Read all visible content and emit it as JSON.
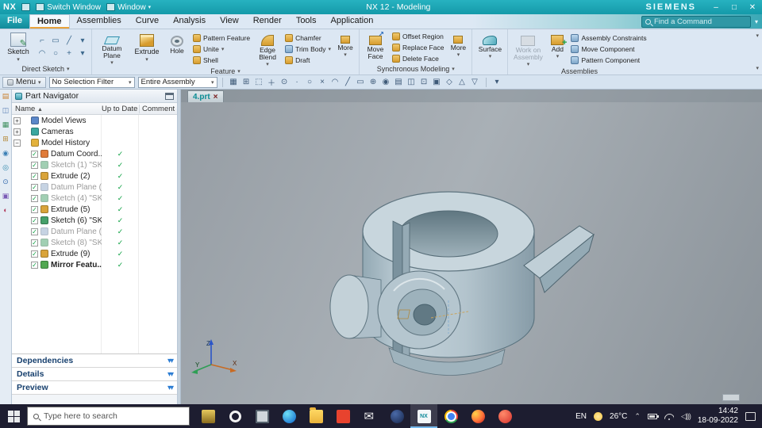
{
  "colors": {
    "titlebar_teal": "#149aa9",
    "ribbon_bg": "#dce7f3",
    "check_green": "#0aa040",
    "taskbar_dark": "#1d1d30",
    "tab_text_teal": "#0a8c94"
  },
  "titlebar": {
    "logo": "NX",
    "switch_window": "Switch Window",
    "window_menu": "Window",
    "title": "NX 12 - Modeling",
    "brand": "SIEMENS",
    "minimize": "–",
    "maximize": "□",
    "close": "✕"
  },
  "menubar": {
    "search_placeholder": "Find a Command",
    "items": [
      {
        "name": "menu-file",
        "label": "File",
        "state": "m-file"
      },
      {
        "name": "tab-home",
        "label": "Home",
        "state": "m-active"
      },
      {
        "name": "tab-assemblies",
        "label": "Assemblies",
        "state": ""
      },
      {
        "name": "tab-curve",
        "label": "Curve",
        "state": ""
      },
      {
        "name": "tab-analysis",
        "label": "Analysis",
        "state": ""
      },
      {
        "name": "tab-view",
        "label": "View",
        "state": ""
      },
      {
        "name": "tab-render",
        "label": "Render",
        "state": ""
      },
      {
        "name": "tab-tools",
        "label": "Tools",
        "state": ""
      },
      {
        "name": "tab-application",
        "label": "Application",
        "state": ""
      }
    ]
  },
  "ribbon": {
    "sketch": "Sketch",
    "direct_sketch_icons": [
      {
        "name": "profile-icon",
        "glyph": "⌐"
      },
      {
        "name": "rectangle-icon",
        "glyph": "▭"
      },
      {
        "name": "line-icon",
        "glyph": "╱"
      },
      {
        "name": "more-curve-icon",
        "glyph": "▾"
      },
      {
        "name": "arc-icon",
        "glyph": "◠"
      },
      {
        "name": "circle-icon",
        "glyph": "○"
      },
      {
        "name": "fillet-icon",
        "glyph": "+"
      },
      {
        "name": "more-curve2-icon",
        "glyph": "▾"
      }
    ],
    "datum_plane": "Datum Plane",
    "extrude": "Extrude",
    "hole": "Hole",
    "pattern_feature": "Pattern Feature",
    "unite": "Unite",
    "shell": "Shell",
    "edge_blend": "Edge Blend",
    "chamfer": "Chamfer",
    "trim_body": "Trim Body",
    "draft": "Draft",
    "more_feature": "More",
    "move_face": "Move Face",
    "offset_region": "Offset Region",
    "replace_face": "Replace Face",
    "delete_face": "Delete Face",
    "more_sync": "More",
    "surface": "Surface",
    "work_on_assembly": "Work on Assembly",
    "add": "Add",
    "assembly_constraints": "Assembly Constraints",
    "move_component": "Move Component",
    "pattern_component": "Pattern Component"
  },
  "group_labels": {
    "direct_sketch": "Direct Sketch",
    "feature": "Feature",
    "synchronous": "Synchronous Modeling",
    "assemblies": "Assemblies"
  },
  "toolbar": {
    "menu": "Menu",
    "selection_filter": "No Selection Filter",
    "scope": "Entire Assembly",
    "icons": [
      {
        "name": "selection-scope-icon",
        "glyph": "▦"
      },
      {
        "name": "snap-grid-icon",
        "glyph": "⊞"
      },
      {
        "name": "window-select-icon",
        "glyph": "⬚"
      },
      {
        "name": "highlight-icon",
        "glyph": "＋"
      },
      {
        "name": "snap-point-icon",
        "glyph": "⊙"
      },
      {
        "name": "endpoint-icon",
        "glyph": "∙"
      },
      {
        "name": "circle-center-icon",
        "glyph": "○"
      },
      {
        "name": "intersection-icon",
        "glyph": "×"
      },
      {
        "name": "arc-snap-icon",
        "glyph": "◠"
      },
      {
        "name": "line-snap-icon",
        "glyph": "╱"
      },
      {
        "name": "face-snap-icon",
        "glyph": "▭"
      },
      {
        "name": "quadrant-icon",
        "glyph": "⊕"
      },
      {
        "name": "existing-point-icon",
        "glyph": "◉"
      },
      {
        "name": "shaded-view-icon",
        "glyph": "▤"
      },
      {
        "name": "wireframe-icon",
        "glyph": "◫"
      },
      {
        "name": "fit-view-icon",
        "glyph": "⊡"
      },
      {
        "name": "render-style-icon",
        "glyph": "▣"
      },
      {
        "name": "orient-view-icon",
        "glyph": "◇"
      },
      {
        "name": "up-view-icon",
        "glyph": "△"
      },
      {
        "name": "down-view-icon",
        "glyph": "▽"
      }
    ]
  },
  "resource_bar": {
    "icons": [
      {
        "name": "assembly-navigator-icon",
        "glyph": "▤",
        "style": "color:#c77f2e"
      },
      {
        "name": "constraint-navigator-icon",
        "glyph": "◫",
        "style": "color:#5a7fb5"
      },
      {
        "name": "part-navigator-icon",
        "glyph": "▦",
        "style": "color:#3f8f5f"
      },
      {
        "name": "reuse-library-icon",
        "glyph": "⊞",
        "style": "color:#b58a3a"
      },
      {
        "name": "hd3d-tools-icon",
        "glyph": "◉",
        "style": "color:#3a7fb5"
      },
      {
        "name": "web-browser-icon",
        "glyph": "◎",
        "style": "color:#2e86ab"
      },
      {
        "name": "history-icon",
        "glyph": "⊙",
        "style": "color:#3a6fb0"
      },
      {
        "name": "process-studio-icon",
        "glyph": "▣",
        "style": "color:#7a5ab5"
      },
      {
        "name": "roles-icon",
        "glyph": "◐",
        "style": "color:#b03a5a"
      }
    ]
  },
  "part_navigator": {
    "title": "Part Navigator",
    "col_name": "Name",
    "col_uptodate": "Up to Date",
    "col_comment": "Comment",
    "rows": [
      {
        "indent": "ind0",
        "expand": "+",
        "check": "",
        "icon": "ic-views",
        "label": "Model Views",
        "state": "",
        "uptodate": ""
      },
      {
        "indent": "ind0",
        "expand": "+",
        "check": "",
        "icon": "ic-cameras",
        "label": "Cameras",
        "state": "",
        "uptodate": ""
      },
      {
        "indent": "ind0",
        "expand": "−",
        "check": "",
        "icon": "ic-history",
        "label": "Model History",
        "state": "",
        "uptodate": ""
      },
      {
        "indent": "ind1",
        "expand": "",
        "check": "✓",
        "icon": "ic-csys",
        "label": "Datum Coord...",
        "state": "",
        "uptodate": "✓"
      },
      {
        "indent": "ind1",
        "expand": "",
        "check": "✓",
        "icon": "ic-sketch",
        "label": "Sketch (1) \"SK...",
        "state": "grayed",
        "uptodate": "✓"
      },
      {
        "indent": "ind1",
        "expand": "",
        "check": "✓",
        "icon": "ic-extrude2",
        "label": "Extrude (2)",
        "state": "",
        "uptodate": "✓"
      },
      {
        "indent": "ind1",
        "expand": "",
        "check": "✓",
        "icon": "ic-datum",
        "label": "Datum Plane (...",
        "state": "grayed",
        "uptodate": "✓"
      },
      {
        "indent": "ind1",
        "expand": "",
        "check": "✓",
        "icon": "ic-sketch",
        "label": "Sketch (4) \"SK...",
        "state": "grayed",
        "uptodate": "✓"
      },
      {
        "indent": "ind1",
        "expand": "",
        "check": "✓",
        "icon": "ic-extrude2",
        "label": "Extrude (5)",
        "state": "",
        "uptodate": "✓"
      },
      {
        "indent": "ind1",
        "expand": "",
        "check": "✓",
        "icon": "ic-sketch",
        "label": "Sketch (6) \"SK...",
        "state": "",
        "uptodate": "✓"
      },
      {
        "indent": "ind1",
        "expand": "",
        "check": "✓",
        "icon": "ic-datum",
        "label": "Datum Plane (...",
        "state": "grayed",
        "uptodate": "✓"
      },
      {
        "indent": "ind1",
        "expand": "",
        "check": "✓",
        "icon": "ic-sketch",
        "label": "Sketch (8) \"SK...",
        "state": "grayed",
        "uptodate": "✓"
      },
      {
        "indent": "ind1",
        "expand": "",
        "check": "✓",
        "icon": "ic-extrude2",
        "label": "Extrude (9)",
        "state": "",
        "uptodate": "✓"
      },
      {
        "indent": "ind1",
        "expand": "",
        "check": "✓",
        "icon": "ic-mirror",
        "label": "Mirror Featu...",
        "state": "selected",
        "uptodate": "✓"
      }
    ],
    "sections": [
      {
        "name": "section-dependencies",
        "label": "Dependencies"
      },
      {
        "name": "section-details",
        "label": "Details"
      },
      {
        "name": "section-preview",
        "label": "Preview"
      }
    ]
  },
  "viewport": {
    "tab": "4.prt",
    "tab_close": "×",
    "triad_x": "X",
    "triad_y": "Y",
    "triad_z": "Z"
  },
  "taskbar": {
    "search_placeholder": "Type here to search",
    "language": "EN",
    "temperature": "26°C",
    "time": "14:42",
    "date": "18-09-2022",
    "app_icons": [
      {
        "name": "app-temple-icon",
        "cls": "tb-temple"
      },
      {
        "name": "app-opera-icon",
        "cls": "tb-opera"
      },
      {
        "name": "task-view-icon",
        "cls": "tb-taskview"
      },
      {
        "name": "app-edge-icon",
        "cls": "tb-edge"
      },
      {
        "name": "file-explorer-icon",
        "cls": "tb-folder"
      },
      {
        "name": "app-red-icon",
        "cls": "tb-redapp"
      },
      {
        "name": "mail-icon",
        "cls": "tb-mail"
      },
      {
        "name": "app-dark-icon",
        "cls": "tb-darkapp"
      },
      {
        "name": "nx-app-icon",
        "cls": "tb-nx",
        "slot": "slot-active"
      },
      {
        "name": "app-chrome-icon",
        "cls": "tb-chrome"
      },
      {
        "name": "app-firefox-icon",
        "cls": "tb-firefox"
      },
      {
        "name": "app-red2-icon",
        "cls": "tb-red2"
      }
    ]
  }
}
